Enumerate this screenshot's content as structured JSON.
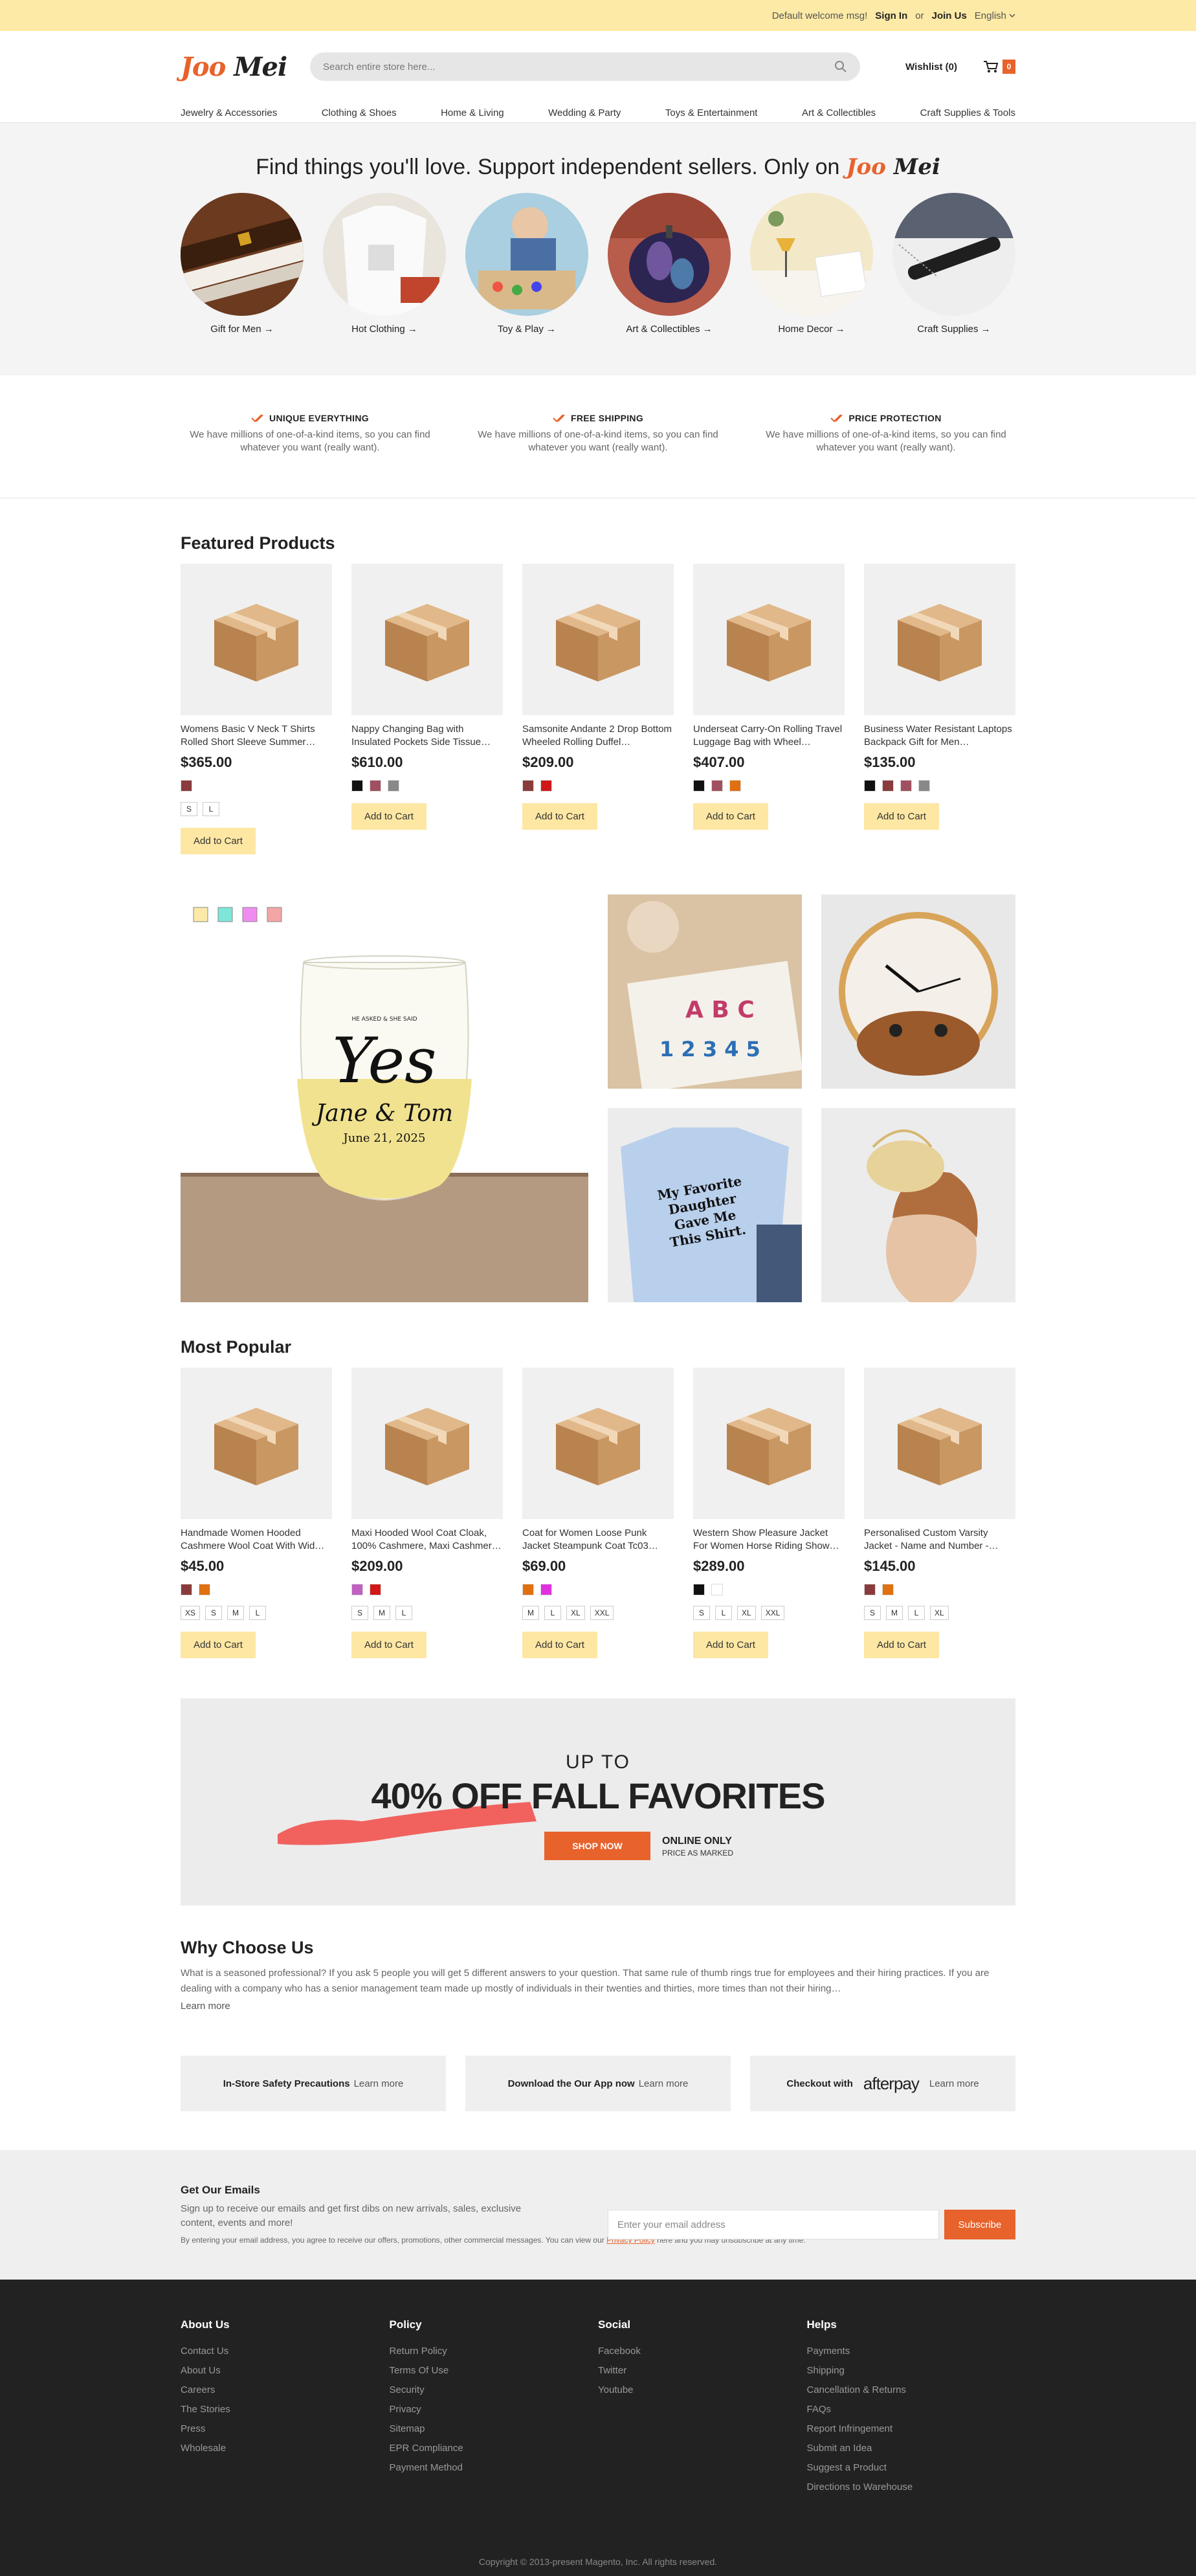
{
  "topbar": {
    "welcome": "Default welcome msg!",
    "sign_in": "Sign In",
    "or": "or",
    "join": "Join Us",
    "language": "English"
  },
  "header": {
    "logo_a": "Joo",
    "logo_b": "Mei",
    "search_placeholder": "Search entire store here...",
    "wishlist": "Wishlist (0)",
    "cart_count": "0"
  },
  "nav": [
    "Jewelry & Accessories",
    "Clothing & Shoes",
    "Home & Living",
    "Wedding & Party",
    "Toys & Entertainment",
    "Art & Collectibles",
    "Craft Supplies & Tools"
  ],
  "hero": {
    "headline": "Find things you'll love. Support independent sellers. Only on",
    "categories": [
      {
        "label": "Gift for Men →"
      },
      {
        "label": "Hot Clothing →"
      },
      {
        "label": "Toy & Play →"
      },
      {
        "label": "Art & Collectibles →"
      },
      {
        "label": "Home Decor →"
      },
      {
        "label": "Craft Supplies →"
      }
    ]
  },
  "features": [
    {
      "title": "UNIQUE EVERYTHING",
      "desc": "We have millions of one-of-a-kind items, so you can find whatever you want (really want)."
    },
    {
      "title": "FREE SHIPPING",
      "desc": "We have millions of one-of-a-kind items, so you can find whatever you want (really want)."
    },
    {
      "title": "PRICE PROTECTION",
      "desc": "We have millions of one-of-a-kind items, so you can find whatever you want (really want)."
    }
  ],
  "featured": {
    "title": "Featured Products",
    "products": [
      {
        "name": "Womens Basic V Neck T Shirts Rolled Short Sleeve Summer…",
        "price": "$365.00",
        "colors": [
          "#8a3b3b"
        ],
        "sizes": [
          "S",
          "L"
        ],
        "cta": "Add to Cart"
      },
      {
        "name": "Nappy Changing Bag with Insulated Pockets Side Tissue…",
        "price": "$610.00",
        "colors": [
          "#111111",
          "#a05060",
          "#888888"
        ],
        "sizes": [],
        "cta": "Add to Cart"
      },
      {
        "name": "Samsonite Andante 2 Drop Bottom Wheeled Rolling Duffel…",
        "price": "$209.00",
        "colors": [
          "#8a3b3b",
          "#d01818"
        ],
        "sizes": [],
        "cta": "Add to Cart"
      },
      {
        "name": "Underseat Carry-On Rolling Travel Luggage Bag with Wheel…",
        "price": "$407.00",
        "colors": [
          "#111111",
          "#a05060",
          "#e07010"
        ],
        "sizes": [],
        "cta": "Add to Cart"
      },
      {
        "name": "Business Water Resistant Laptops Backpack Gift for Men…",
        "price": "$135.00",
        "colors": [
          "#111111",
          "#8a3b3b",
          "#a05060",
          "#888888"
        ],
        "sizes": [],
        "cta": "Add to Cart"
      }
    ]
  },
  "mosaic": {
    "glass_small": "HE ASKED & SHE SAID",
    "glass_yes": "Yes",
    "glass_names": "Jane & Tom",
    "glass_date": "June 21, 2025",
    "shirt_text": [
      "My Favorite",
      "Daughter",
      "Gave Me",
      "This Shirt."
    ],
    "swatch_colors": [
      "#fbe9a8",
      "#7ee6d8",
      "#f08cf0",
      "#f4a6a6"
    ]
  },
  "popular": {
    "title": "Most Popular",
    "products": [
      {
        "name": "Handmade Women Hooded Cashmere Wool Coat With Wid…",
        "price": "$45.00",
        "colors": [
          "#8a3b3b",
          "#e07010"
        ],
        "sizes": [
          "XS",
          "S",
          "M",
          "L"
        ],
        "cta": "Add to Cart"
      },
      {
        "name": "Maxi Hooded Wool Coat Cloak, 100% Cashmere, Maxi Cashmer…",
        "price": "$209.00",
        "colors": [
          "#c060c0",
          "#d01818"
        ],
        "sizes": [
          "S",
          "M",
          "L"
        ],
        "cta": "Add to Cart"
      },
      {
        "name": "Coat for Women Loose Punk Jacket Steampunk Coat Tc03…",
        "price": "$69.00",
        "colors": [
          "#e07010",
          "#e030e0"
        ],
        "sizes": [
          "M",
          "L",
          "XL",
          "XXL"
        ],
        "cta": "Add to Cart"
      },
      {
        "name": "Western Show Pleasure Jacket For Women Horse Riding Show…",
        "price": "$289.00",
        "colors": [
          "#111111",
          "#ffffff"
        ],
        "sizes": [
          "S",
          "L",
          "XL",
          "XXL"
        ],
        "cta": "Add to Cart"
      },
      {
        "name": "Personalised Custom Varsity Jacket - Name and Number -…",
        "price": "$145.00",
        "colors": [
          "#8a3b3b",
          "#e07010"
        ],
        "sizes": [
          "S",
          "M",
          "L",
          "XL"
        ],
        "cta": "Add to Cart"
      }
    ]
  },
  "promo": {
    "upto": "UP TO",
    "headline": "40% OFF FALL FAVORITES",
    "button": "SHOP NOW",
    "online": "ONLINE ONLY",
    "marked": "PRICE AS MARKED"
  },
  "why": {
    "title": "Why Choose Us",
    "body": "What is a seasoned professional? If you ask 5 people you will get 5 different answers to your question. That same rule of thumb rings true for employees and their hiring practices. If you are dealing with a company who has a senior management team made up mostly of individuals in their twenties and thirties, more times than not their hiring…",
    "learn_more": "Learn more",
    "boxes": [
      {
        "bold": "In-Store Safety Precautions",
        "link": "Learn more"
      },
      {
        "bold": "Download the Our App now",
        "link": "Learn more"
      },
      {
        "bold": "Checkout with",
        "brand": "afterpay",
        "link": "Learn more"
      }
    ]
  },
  "newsletter": {
    "title": "Get Our Emails",
    "sub": "Sign up to receive our emails and get first dibs on new arrivals, sales, exclusive content, events and more!",
    "placeholder": "Enter your email address",
    "button": "Subscribe",
    "fine_a": "By entering your email address, you agree to receive our offers, promotions, other commercial messages. You can view our",
    "fine_link": "Privacy Policy",
    "fine_b": "here and you may unsubscribe at any time."
  },
  "footer": {
    "columns": [
      {
        "title": "About Us",
        "items": [
          "Contact Us",
          "About Us",
          "Careers",
          "The Stories",
          "Press",
          "Wholesale"
        ]
      },
      {
        "title": "Policy",
        "items": [
          "Return Policy",
          "Terms Of Use",
          "Security",
          "Privacy",
          "Sitemap",
          "EPR Compliance",
          "Payment Method"
        ]
      },
      {
        "title": "Social",
        "items": [
          "Facebook",
          "Twitter",
          "Youtube"
        ]
      },
      {
        "title": "Helps",
        "items": [
          "Payments",
          "Shipping",
          "Cancellation & Returns",
          "FAQs",
          "Report Infringement",
          "Submit an Idea",
          "Suggest a Product",
          "Directions to Warehouse"
        ]
      }
    ],
    "copyright": "Copyright © 2013-present Magento, Inc. All rights reserved."
  },
  "colors": {
    "accent": "#e8622c",
    "button_bg": "#fde7a3",
    "topbar_bg": "#fdeaa6",
    "footer_bg": "#222222"
  }
}
